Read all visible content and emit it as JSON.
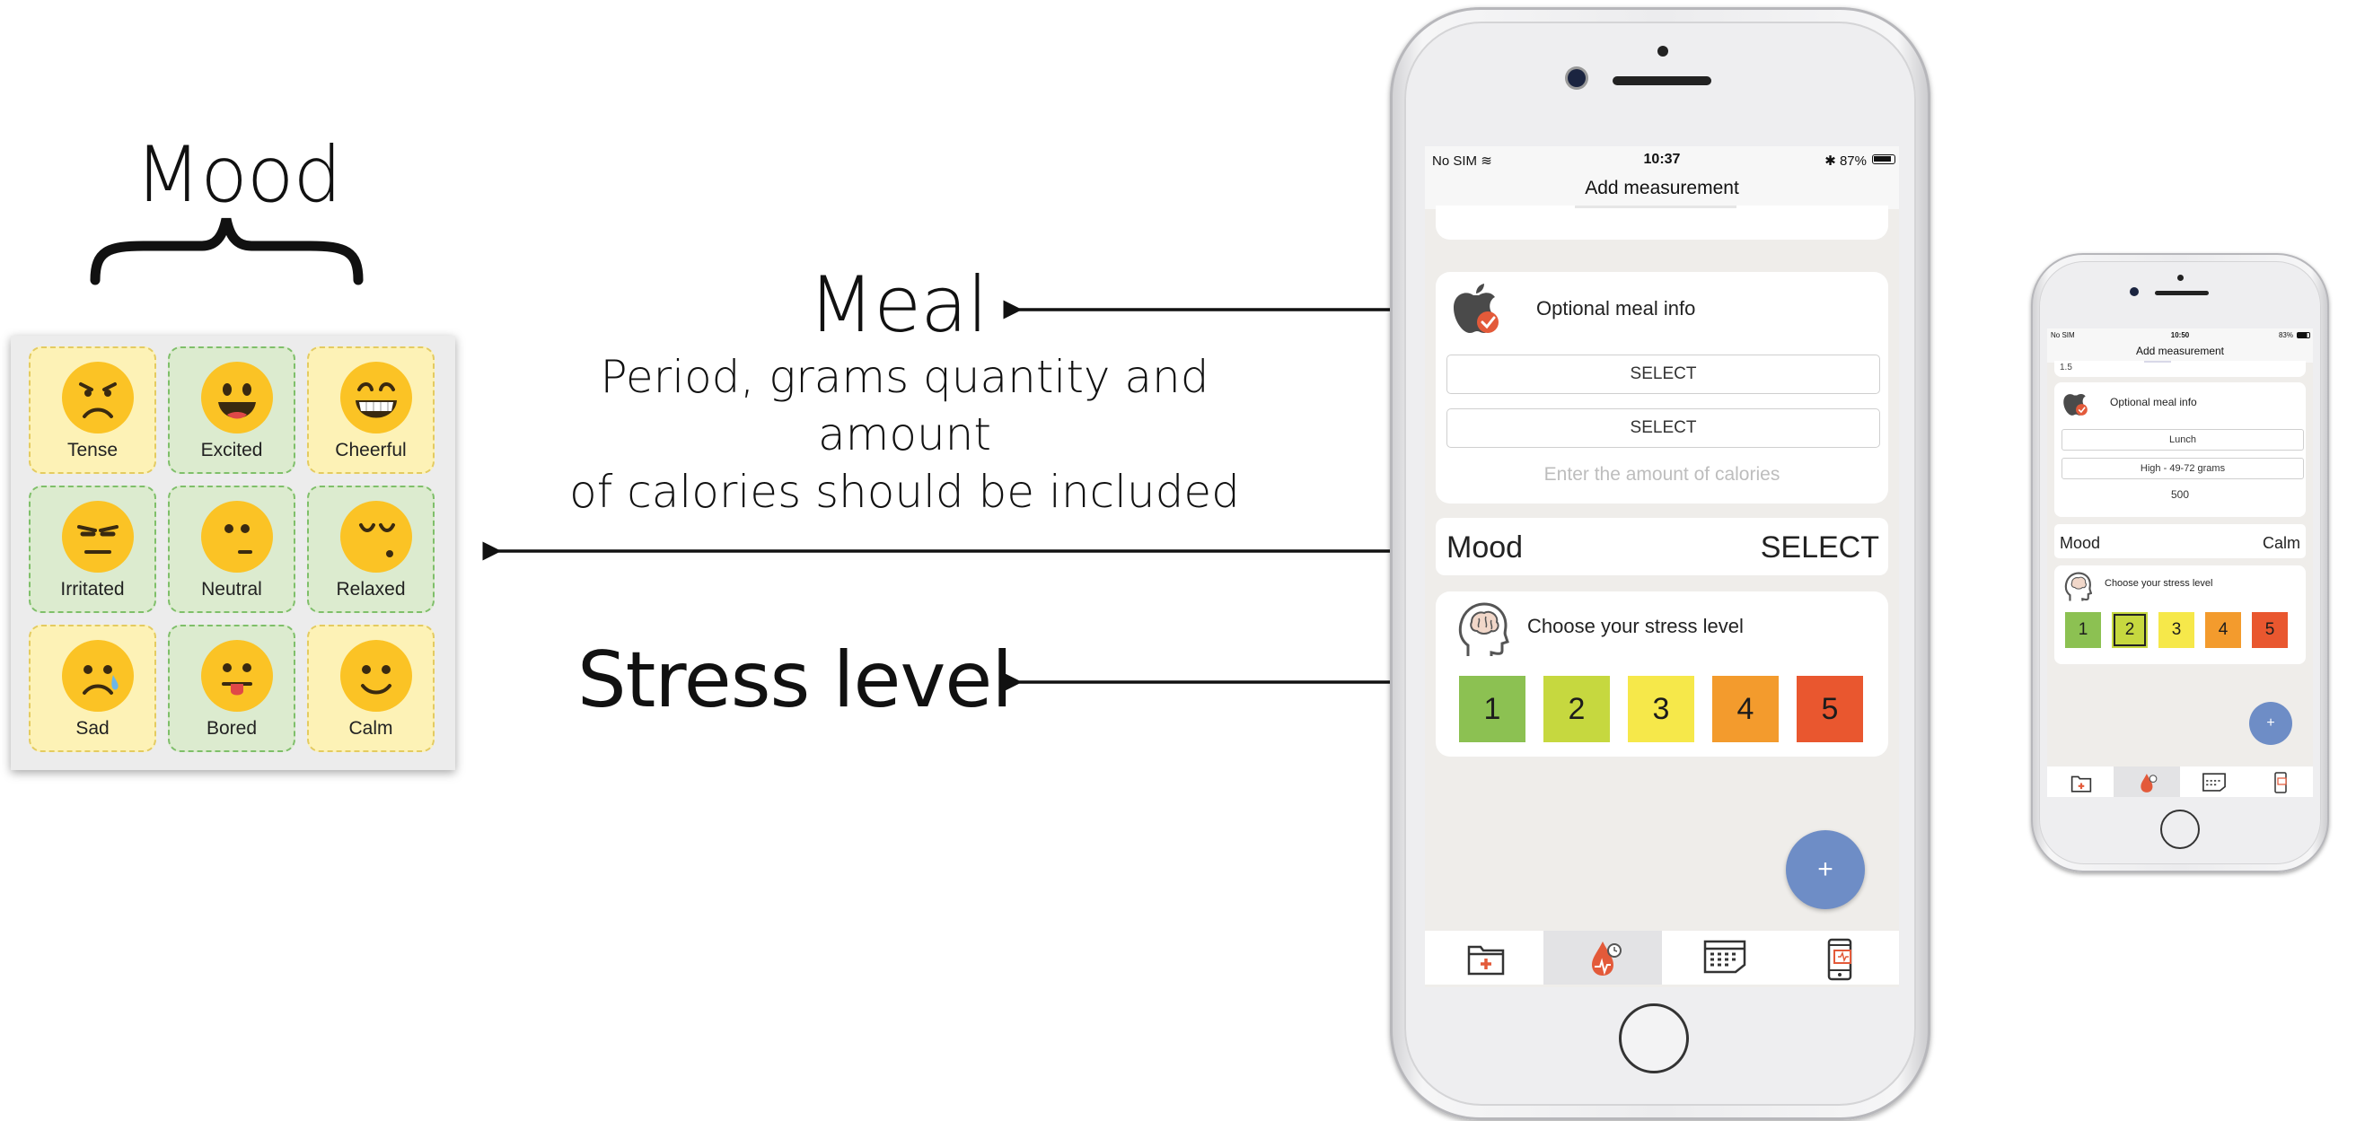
{
  "mood_legend": {
    "title": "Mood",
    "cells": [
      {
        "label": "Tense",
        "bg": "yellow",
        "face": "tense"
      },
      {
        "label": "Excited",
        "bg": "green",
        "face": "excited"
      },
      {
        "label": "Cheerful",
        "bg": "yellow",
        "face": "cheerful"
      },
      {
        "label": "Irritated",
        "bg": "green",
        "face": "irritated"
      },
      {
        "label": "Neutral",
        "bg": "green",
        "face": "neutral"
      },
      {
        "label": "Relaxed",
        "bg": "green",
        "face": "relaxed"
      },
      {
        "label": "Sad",
        "bg": "yellow",
        "face": "sad"
      },
      {
        "label": "Bored",
        "bg": "green",
        "face": "bored"
      },
      {
        "label": "Calm",
        "bg": "yellow",
        "face": "calm"
      }
    ]
  },
  "annotations": {
    "meal_title": "Meal",
    "meal_desc_line1": "Period, grams quantity and amount",
    "meal_desc_line2": "of calories should be included",
    "stress_title": "Stress level"
  },
  "main_phone": {
    "status": {
      "carrier": "No SIM",
      "time": "10:37",
      "battery": "87%"
    },
    "nav_title": "Add measurement",
    "meal_card": {
      "title": "Optional meal info",
      "period_button": "SELECT",
      "grams_button": "SELECT",
      "calories_placeholder": "Enter the amount of calories"
    },
    "mood_row": {
      "label": "Mood",
      "value": "SELECT"
    },
    "stress_card": {
      "title": "Choose your stress level",
      "levels": [
        "1",
        "2",
        "3",
        "4",
        "5"
      ]
    },
    "fab_label": "+",
    "tabs": [
      "medical-folder-icon",
      "blood-drop-icon",
      "calendar-icon",
      "phone-icon"
    ]
  },
  "small_phone": {
    "status": {
      "carrier": "No SIM",
      "time": "10:50",
      "battery": "83%"
    },
    "nav_title": "Add measurement",
    "top_value": "1.5",
    "meal_card": {
      "title": "Optional meal info",
      "period_value": "Lunch",
      "grams_value": "High - 49-72 grams",
      "calories_value": "500"
    },
    "mood_row": {
      "label": "Mood",
      "value": "Calm"
    },
    "stress_card": {
      "title": "Choose your stress level",
      "levels": [
        "1",
        "2",
        "3",
        "4",
        "5"
      ],
      "selected": "2"
    },
    "fab_label": "+"
  },
  "colors": {
    "stress_levels": [
      "#8cc152",
      "#c6d83f",
      "#f6e84a",
      "#f39b2d",
      "#e9572f"
    ],
    "accent_blue": "#6e8dc6",
    "meal_icon_red": "#e35a3a",
    "face_yellow": "#fbc325"
  }
}
